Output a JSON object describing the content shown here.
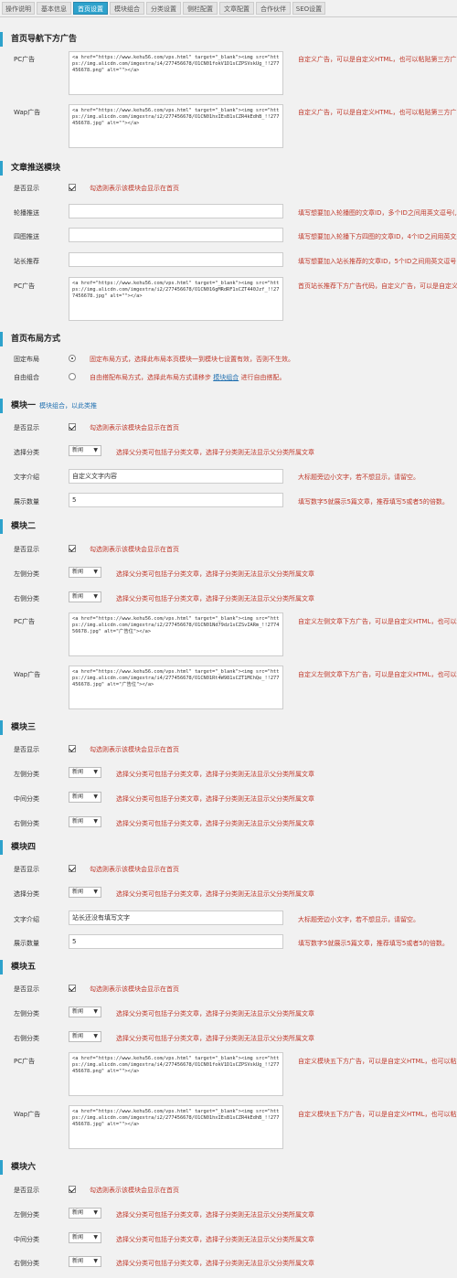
{
  "tabs": [
    "操作说明",
    "基本信息",
    "首页设置",
    "模块组合",
    "分类设置",
    "侧栏配置",
    "文章配置",
    "合作伙伴",
    "SEO设置"
  ],
  "active_tab": "首页设置",
  "ads": {
    "title": "首页导航下方广告",
    "pc_label": "PC广告",
    "pc_code": "<a href=\"https://www.kehu56.com/vps.html\" target=\"_blank\"><img src=\"https://img.alicdn.com/imgextra/i4/277456678/O1CN01fokV1D1sCZPSVskUg_!!277456678.png\" alt=\"\"></a>",
    "pc_hint": "自定义广告，可以是自定义HTML，也可以粘贴第三方广",
    "wap_label": "Wap广告",
    "wap_code": "<a href=\"https://www.kehu56.com/vps.html\" target=\"_blank\"><img src=\"https://img.alicdn.com/imgextra/i2/277456678/O1CN01hxIEsB1sCZR4kEdhB_!!277456678.jpg\" alt=\"\"></a>",
    "wap_hint": "自定义广告，可以是自定义HTML，也可以粘贴第三方广"
  },
  "push": {
    "title": "文章推送模块",
    "show_label": "是否显示",
    "show_hint": "勾选则表示该模块会显示在首页",
    "carousel_label": "轮播推送",
    "carousel_hint": "填写想要加入轮播图的文章ID，多个ID之间用英文逗号(,)分",
    "grid_label": "四图推送",
    "grid_hint": "填写想要加入轮播下方四图的文章ID，4个ID之间用英文逗",
    "recommend_label": "站长推荐",
    "recommend_hint": "填写想要加入站长推荐的文章ID，5个ID之间用英文逗号(,)",
    "pc_label": "PC广告",
    "pc_code": "<a href=\"https://www.kehu56.com/vps.html\" target=\"_blank\"><img src=\"https://img.alicdn.com/imgextra/i2/277456678/O1CN016gMRdRF1sCZT440Jzf_!!277456678.jpg\" alt=\"\"></a>",
    "pc_hint": "首页站长推荐下方广告代码，自定义广告，可以是自定义H"
  },
  "layout": {
    "title": "首页布局方式",
    "fixed_label": "固定布局",
    "fixed_hint": "固定布局方式，选择此布局本页模块一到模块七设置有效，否则不生效。",
    "free_label": "自由组合",
    "free_hint_pre": "自由搭配布局方式，选择此布局方式请移步",
    "free_hint_link": "模块组合",
    "free_hint_post": "进行自由搭配。"
  },
  "common": {
    "show_label": "是否显示",
    "show_hint": "勾选则表示该模块会显示在首页",
    "cat_label": "选择分类",
    "left_label": "左侧分类",
    "mid_label": "中间分类",
    "right_label": "右侧分类",
    "select_value": "新闻",
    "cat_hint": "选择父分类可包括子分类文章，选择子分类则无法显示父分类所属文章",
    "text_label": "文字介绍",
    "text_hint": "大标题旁边小文字，若不想显示，请留空。",
    "count_label": "展示数量",
    "count_hint": "填写数字5就展示5篇文章，推荐填写5或者5的倍数。",
    "pc_label": "PC广告",
    "wap_label": "Wap广告"
  },
  "m1": {
    "title": "模块一",
    "sub": "模块组合，以此类推",
    "text_value": "自定义文字内容",
    "count_value": "5"
  },
  "m2": {
    "title": "模块二",
    "pc_code": "<a href=\"https://www.kehu56.com/vps.html\" target=\"_blank\"><img src=\"https://img.alicdn.com/imgextra/i2/277456678/O1CN01Nd79dz1sCZSvIARm_!!277456678.jpg\" alt=\"广告位\"></a>",
    "pc_hint": "自定义左侧文章下方广告，可以是自定义HTML，也可以粘",
    "wap_code": "<a href=\"https://www.kehu56.com/vps.html\" target=\"_blank\"><img src=\"https://img.alicdn.com/imgextra/i4/277456678/O1CN01Rt4W981sCZT1MChQe_!!277456678.jpg\" alt=\"广告位\"></a>",
    "wap_hint": "自定义左侧文章下方广告，可以是自定义HTML，也可以粘"
  },
  "m3": {
    "title": "模块三"
  },
  "m4": {
    "title": "模块四",
    "text_value": "站长还没有填写文字",
    "count_value": "5"
  },
  "m5": {
    "title": "模块五",
    "pc_code": "<a href=\"https://www.kehu56.com/vps.html\" target=\"_blank\"><img src=\"https://img.alicdn.com/imgextra/i4/277456678/O1CN01fokV1D1sCZPSVskUg_!!277456678.png\" alt=\"\"></a>",
    "pc_hint": "自定义模块五下方广告，可以是自定义HTML，也可以粘贴",
    "wap_code": "<a href=\"https://www.kehu56.com/vps.html\" target=\"_blank\"><img src=\"https://img.alicdn.com/imgextra/i2/277456678/O1CN01hxIEsB1sCZR4kEdhB_!!277456678.jpg\" alt=\"\"></a>",
    "wap_hint": "自定义模块五下方广告，可以是自定义HTML，也可以粘贴"
  },
  "m6": {
    "title": "模块六"
  },
  "colors": {
    "accent": "#2ea2cc",
    "hint": "#c0392b",
    "link": "#2271b1"
  }
}
